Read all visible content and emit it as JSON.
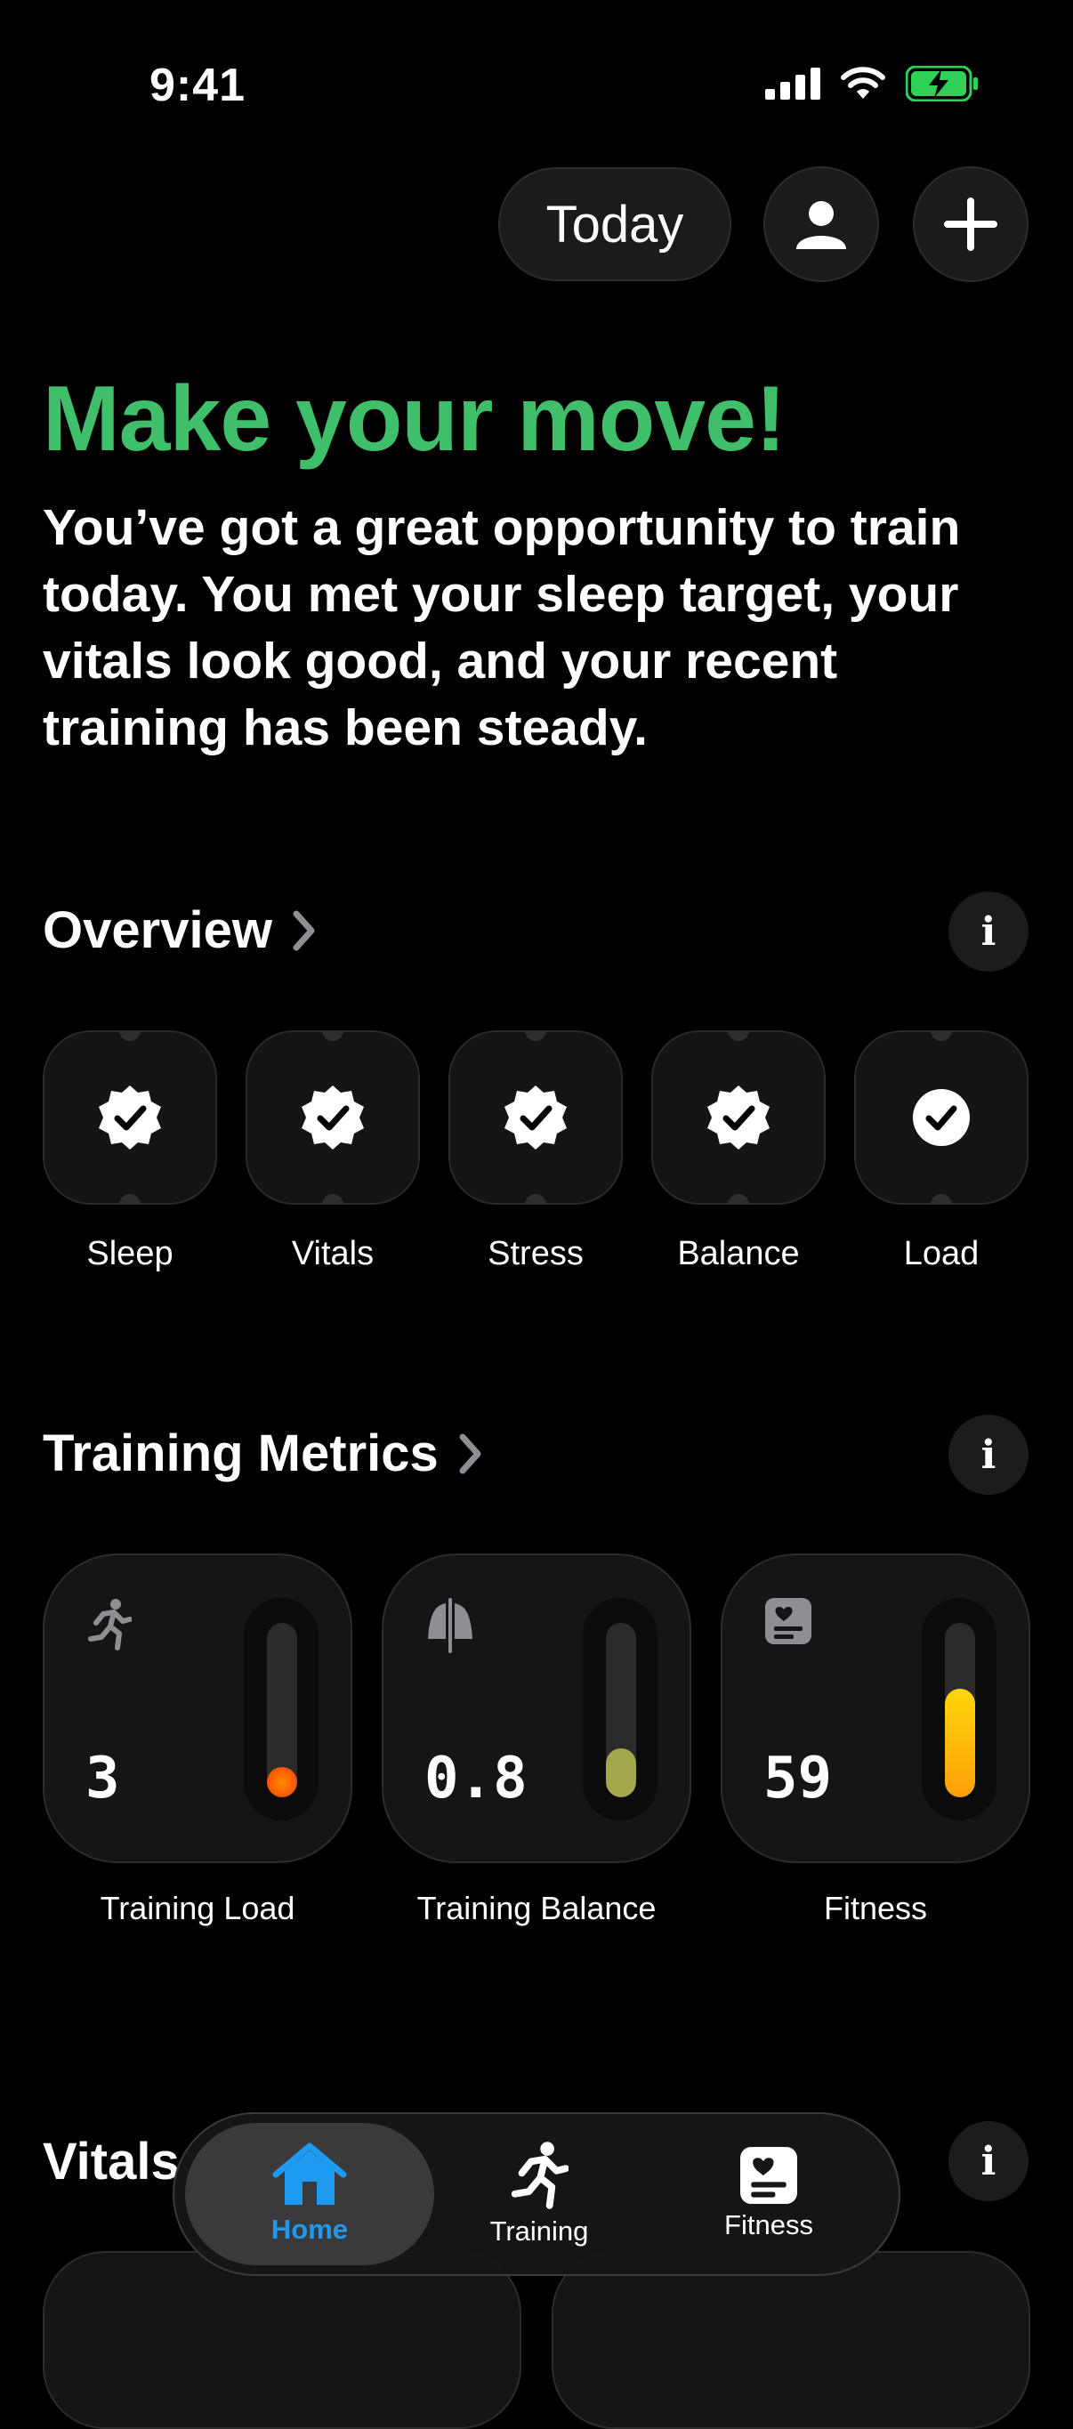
{
  "status_bar": {
    "time": "9:41"
  },
  "header": {
    "today_label": "Today",
    "icons": [
      "person-icon",
      "plus-icon"
    ]
  },
  "hero": {
    "headline": "Make your move!",
    "summary": "You’ve got a great opportunity to train today. You met your sleep target, your vitals look good, and your recent training has been steady."
  },
  "overview": {
    "title": "Overview",
    "items": [
      {
        "label": "Sleep",
        "icon": "badge-check-icon"
      },
      {
        "label": "Vitals",
        "icon": "badge-check-icon"
      },
      {
        "label": "Stress",
        "icon": "badge-check-icon"
      },
      {
        "label": "Balance",
        "icon": "badge-check-icon"
      },
      {
        "label": "Load",
        "icon": "circle-check-icon"
      }
    ]
  },
  "training_metrics": {
    "title": "Training Metrics",
    "cards": [
      {
        "label": "Training Load",
        "value": "3",
        "icon": "runner-icon",
        "level": 0.06,
        "color": "#ff6a00"
      },
      {
        "label": "Training Balance",
        "value": "0.8",
        "icon": "balance-icon",
        "level": 0.28,
        "color": "#a3a84f"
      },
      {
        "label": "Fitness",
        "value": "59",
        "icon": "fitness-card-icon",
        "level": 0.62,
        "color": "#ffc300"
      }
    ]
  },
  "vitals": {
    "title": "Vitals"
  },
  "tabbar": {
    "tabs": [
      {
        "label": "Home",
        "icon": "house-icon",
        "active": true
      },
      {
        "label": "Training",
        "icon": "runner-icon",
        "active": false
      },
      {
        "label": "Fitness",
        "icon": "fitness-card-icon",
        "active": false
      }
    ]
  },
  "colors": {
    "accent_green": "#3fbf69",
    "active_tab_blue": "#1e9bf0",
    "battery_green": "#30d158"
  }
}
